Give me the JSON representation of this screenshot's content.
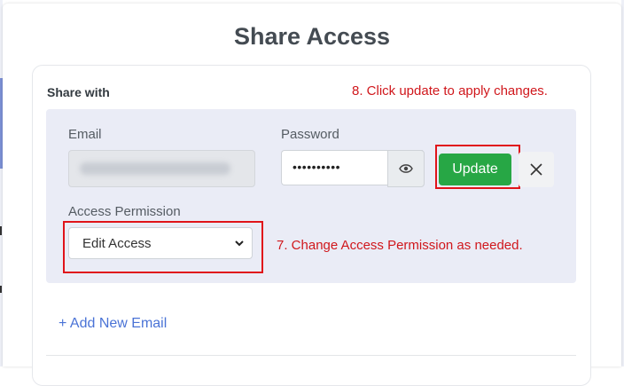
{
  "modal": {
    "title": "Share Access",
    "section_label": "Share with"
  },
  "form": {
    "email_label": "Email",
    "email_value_blurred": "hidden email address",
    "password_label": "Password",
    "password_value": "••••••••••",
    "show_password_icon": "eye-icon",
    "update_label": "Update",
    "remove_icon": "close-icon",
    "permission_label": "Access Permission",
    "permission_selected": "Edit Access",
    "permission_chevron_icon": "chevron-down-icon"
  },
  "annotations": {
    "step8": "8. Click update to apply changes.",
    "step7": "7. Change Access Permission as needed.",
    "highlight_color": "#e0141a"
  },
  "add_email_label": "+ Add New Email",
  "colors": {
    "update_button": "#27a745",
    "panel_background": "#eaecf6",
    "link": "#4a73d6"
  }
}
